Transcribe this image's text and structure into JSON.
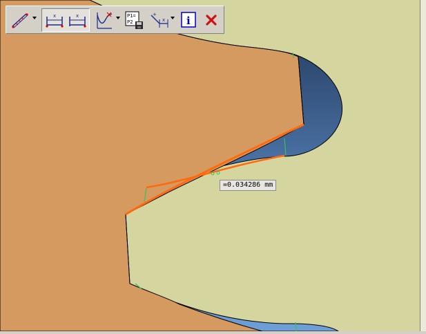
{
  "toolbar": {
    "buttons": [
      {
        "name": "measure-tool-button",
        "icon": "ruler-measure-icon"
      },
      {
        "name": "distance-x-button",
        "icon": "distance-x-icon"
      },
      {
        "name": "distance-point-button",
        "icon": "distance-point-icon"
      },
      {
        "name": "curve-analysis-button",
        "icon": "curve-chart-icon"
      },
      {
        "name": "save-points-button",
        "icon": "p1-p2-save-icon",
        "text": "P1=\nP2"
      },
      {
        "name": "axis-measure-button",
        "icon": "axis-angle-icon"
      },
      {
        "name": "info-button",
        "icon": "info-icon",
        "text": "i"
      },
      {
        "name": "close-button",
        "icon": "close-icon"
      }
    ]
  },
  "measurement": {
    "label": "=0.034286 mm"
  },
  "colors": {
    "background_profile": "#d5d59f",
    "gear_body": "#d59a60",
    "gap_dark": "#26395a",
    "gap_light": "#6a9ad2",
    "deviation_curve": "#ff6a10",
    "marker_green": "#3cc05a",
    "info_blue": "#0000c0",
    "close_red": "#d01010"
  }
}
